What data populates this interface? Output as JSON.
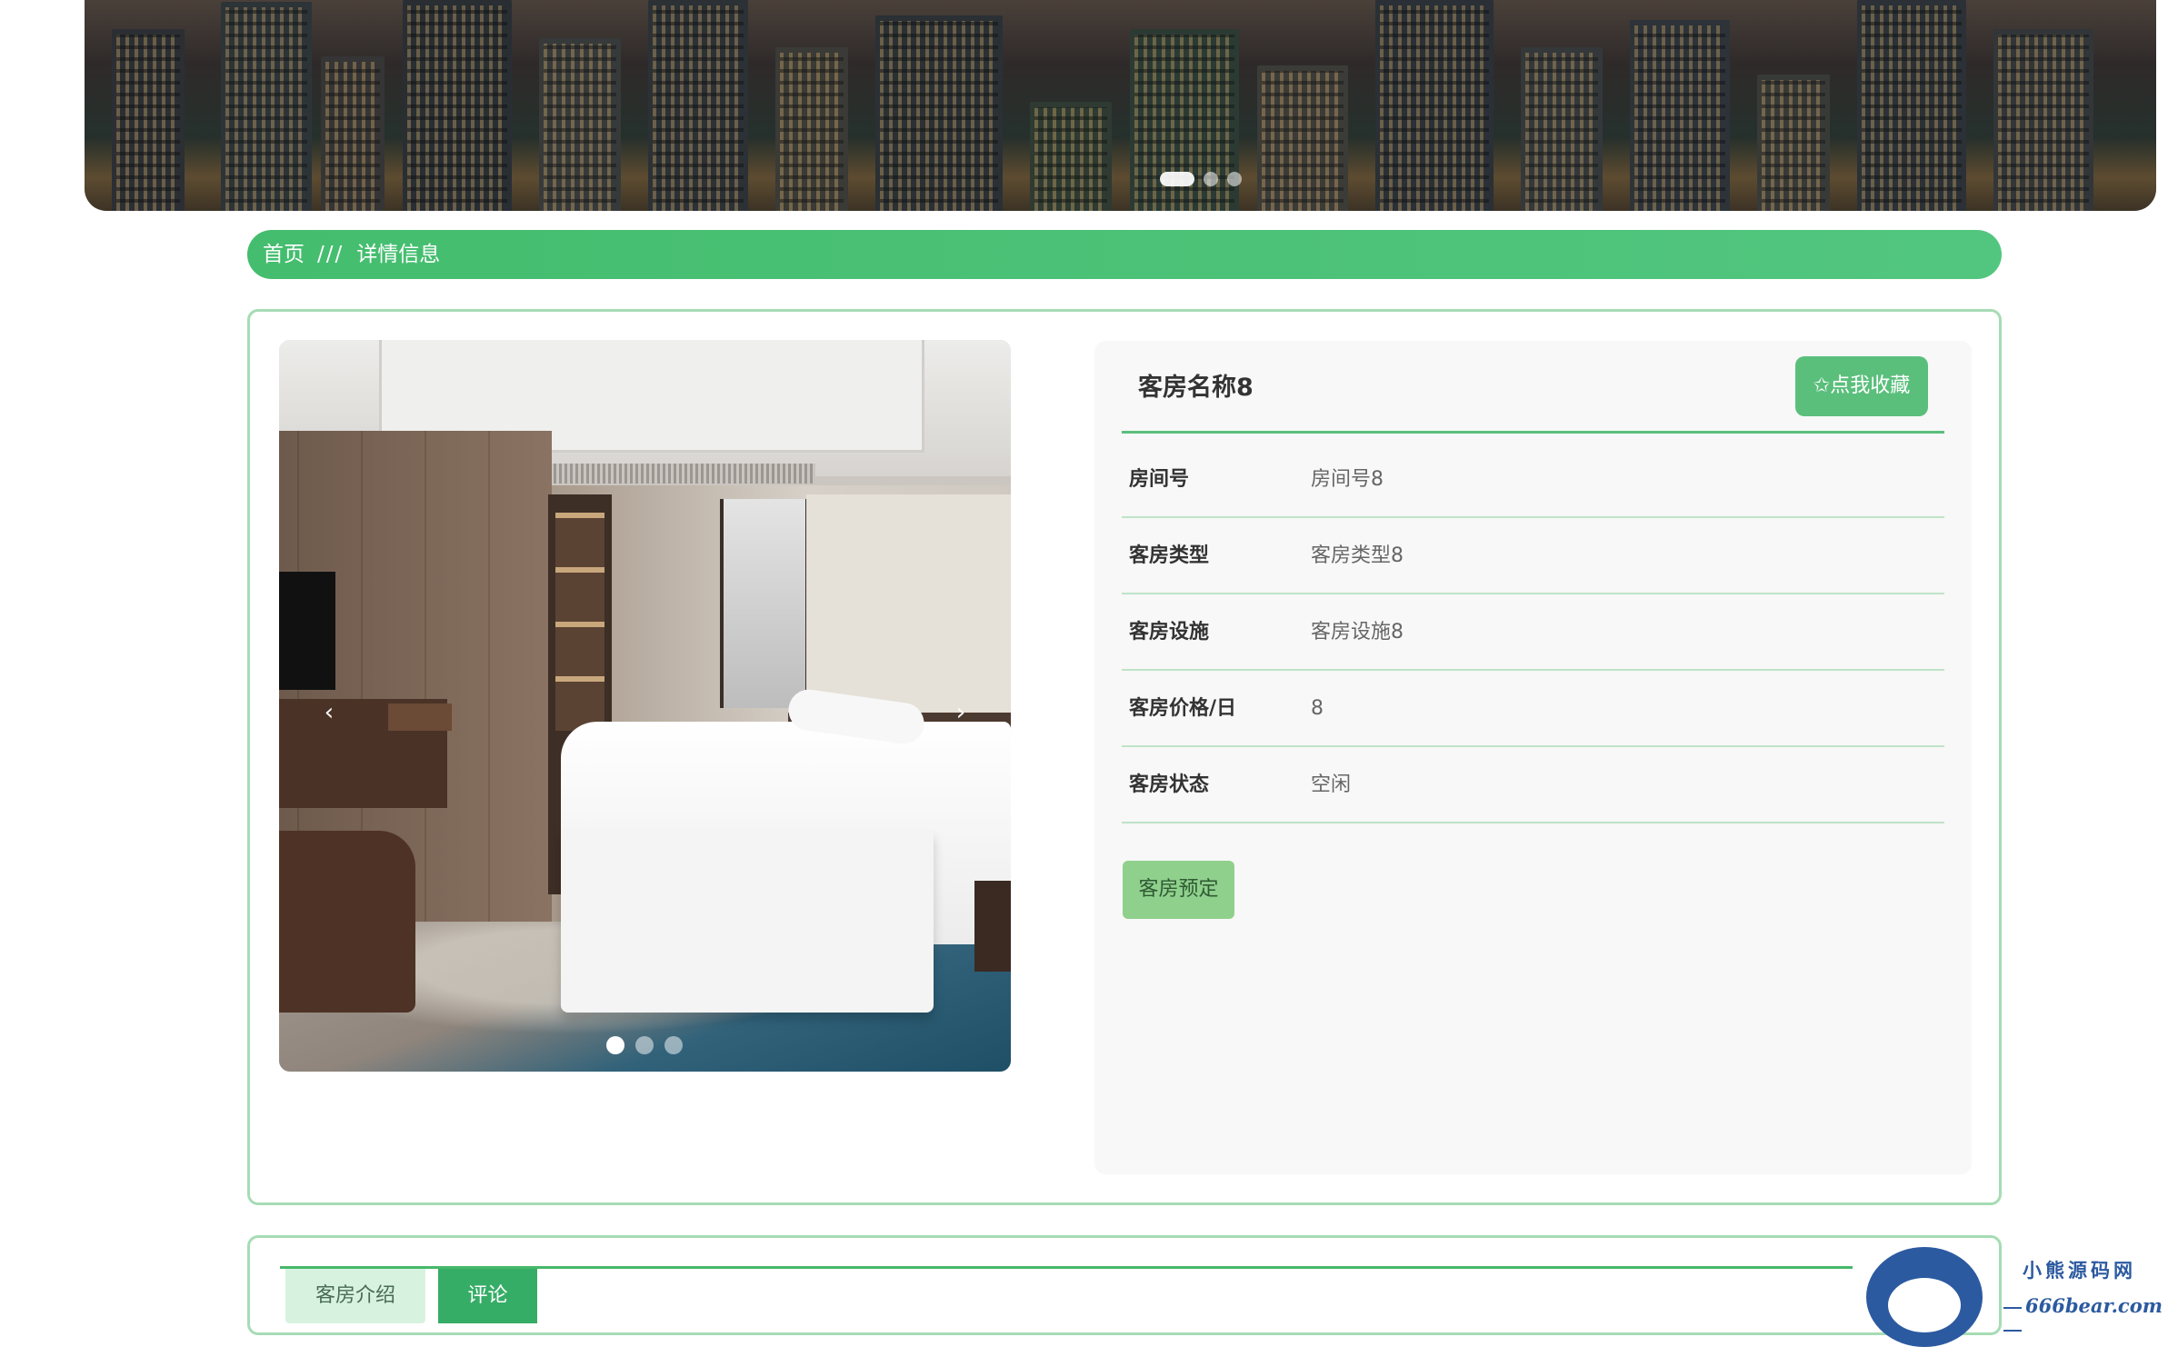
{
  "breadcrumb": {
    "home": "首页",
    "separator": "///",
    "current": "详情信息"
  },
  "banner": {
    "slide_count": 3,
    "active_slide": 1
  },
  "gallery": {
    "prev_icon": "‹",
    "next_icon": "›",
    "slide_count": 3,
    "active_slide": 1
  },
  "room": {
    "title": "客房名称8",
    "favorite_label": "✩点我收藏",
    "fields": [
      {
        "label": "房间号",
        "value": "房间号8"
      },
      {
        "label": "客房类型",
        "value": "客房类型8"
      },
      {
        "label": "客房设施",
        "value": "客房设施8"
      },
      {
        "label": "客房价格/日",
        "value": "8"
      },
      {
        "label": "客房状态",
        "value": "空闲"
      }
    ],
    "book_label": "客房预定"
  },
  "tabs": [
    {
      "label": "客房介绍",
      "active": false
    },
    {
      "label": "评论",
      "active": true
    }
  ],
  "watermark": {
    "line1": "小熊源码网",
    "line2": "666bear.com"
  },
  "colors": {
    "accent": "#46b86a",
    "breadcrumb_bg": "#4dc47a",
    "card_border": "#a6dcb4",
    "book_button": "#90d08d",
    "active_tab": "#36ad66"
  }
}
